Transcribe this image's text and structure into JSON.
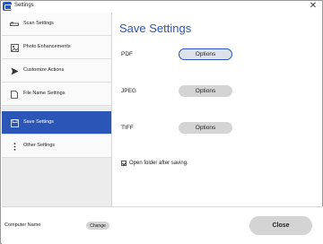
{
  "window": {
    "title": "Settings",
    "close_glyph": "✕"
  },
  "sidebar": {
    "items": [
      {
        "label": "Scan Settings",
        "icon": "scanner-icon",
        "active": false
      },
      {
        "label": "Photo Enhancements",
        "icon": "photo-icon",
        "active": false
      },
      {
        "label": "Customize Actions",
        "icon": "send-icon",
        "active": false
      },
      {
        "label": "File Name Settings",
        "icon": "file-icon",
        "active": false
      },
      {
        "label": "Save Settings",
        "icon": "save-icon",
        "active": true
      },
      {
        "label": "Other Settings",
        "icon": "more-icon",
        "active": false
      }
    ]
  },
  "main": {
    "title": "Save Settings",
    "formats": [
      {
        "label": "PDF",
        "button": "Options"
      },
      {
        "label": "JPEG",
        "button": "Options"
      },
      {
        "label": "TIFF",
        "button": "Options"
      }
    ],
    "open_folder": {
      "label": "Open folder after saving.",
      "checked": true
    }
  },
  "footer": {
    "computer_name_label": "Computer Name",
    "change_label": "Change",
    "close_label": "Close"
  },
  "colors": {
    "accent": "#2b56b8",
    "sidebar_bg": "#ececec",
    "button_bg": "#d4d4d4"
  }
}
